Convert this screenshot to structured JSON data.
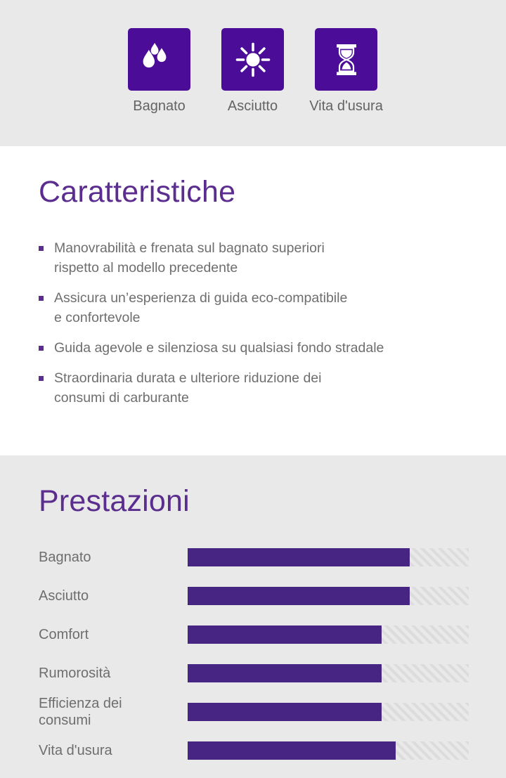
{
  "colors": {
    "tile_purple": "#4b0d98",
    "heading_purple": "#5b2d8e",
    "bar_purple": "#472583",
    "section_gray": "#e9e9e9",
    "text_gray": "#6e6e6e",
    "track_gray": "#e2e2e2"
  },
  "icons": [
    {
      "icon": "water-drops-icon",
      "label": "Bagnato"
    },
    {
      "icon": "sun-icon",
      "label": "Asciutto"
    },
    {
      "icon": "hourglass-icon",
      "label": "Vita d'usura"
    }
  ],
  "features": {
    "title": "Caratteristiche",
    "items": [
      "Manovrabilità e frenata sul bagnato superiori\nrispetto al modello precedente",
      "Assicura un’esperienza di guida eco-compatibile\ne confortevole",
      "Guida agevole e silenziosa su qualsiasi fondo stradale",
      "Straordinaria durata e ulteriore riduzione dei\nconsumi di carburante"
    ]
  },
  "performance": {
    "title": "Prestazioni",
    "rows": [
      {
        "label": "Bagnato",
        "value": 79
      },
      {
        "label": "Asciutto",
        "value": 79
      },
      {
        "label": "Comfort",
        "value": 69
      },
      {
        "label": "Rumorosità",
        "value": 69
      },
      {
        "label": "Efficienza dei\nconsumi",
        "value": 69
      },
      {
        "label": "Vita d'usura",
        "value": 74
      }
    ]
  }
}
